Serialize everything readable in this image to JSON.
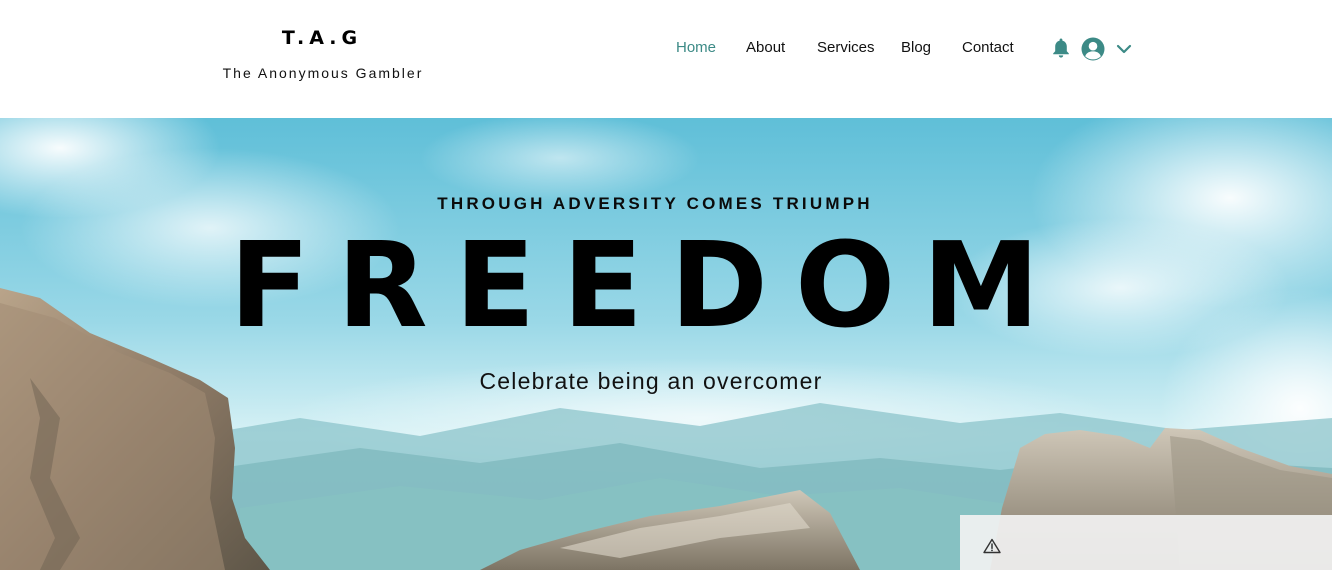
{
  "brand": {
    "title": "T.A.G",
    "subtitle": "The Anonymous Gambler"
  },
  "nav": {
    "items": [
      {
        "label": "Home",
        "active": true
      },
      {
        "label": "About",
        "active": false
      },
      {
        "label": "Services",
        "active": false
      },
      {
        "label": "Blog",
        "active": false
      },
      {
        "label": "Contact",
        "active": false
      }
    ],
    "icons": {
      "notifications": "bell-icon",
      "account": "user-avatar-icon",
      "menu": "chevron-down-icon"
    }
  },
  "hero": {
    "tagline": "THROUGH ADVERSITY COMES TRIUMPH",
    "headline": "FREEDOM",
    "subline": "Celebrate being an overcomer"
  },
  "notice": {
    "icon": "warning-icon"
  },
  "colors": {
    "accent": "#3c8a86",
    "text": "#000000",
    "header_bg": "#ffffff"
  }
}
